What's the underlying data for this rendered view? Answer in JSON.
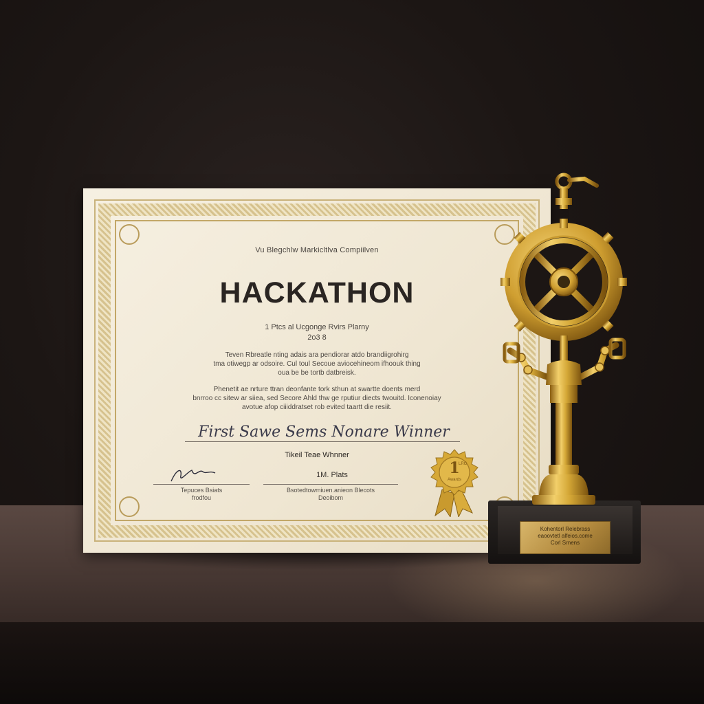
{
  "certificate": {
    "subtitle": "Vu Blegchlw Markicltlva Compiilven",
    "title": "HACKATHON",
    "place_line": "1 Ptcs al Ucgonge Rvirs Plarny",
    "year": "2o3 8",
    "paragraph1": [
      "Teven Rbreatle nting adais ara pendiorar atdo brandiigrohirg",
      "tma otiwegp ar odsoire. Cul toul Secoue aviocehineom ifhoouk thing",
      "oua be be tortb datbreisk."
    ],
    "paragraph2": [
      "Phenetit ae nrture ttran deonfante tork sthun at swartte doents merd",
      "bnrroo cc sitew ar siiea, sed Secore Ahld thw ge rputiur diects twouitd. Iconenoiay",
      "avotue afop ciiiddratset rob evited taartt die resiit."
    ],
    "script_title": "First Sawe Sems Nonare Winner",
    "winner_label": "Tikeil Teae Whnner",
    "sig_left_label": [
      "Tepuces Bsiats",
      "frodfou"
    ],
    "place_label": "1M. Plats",
    "sig_right_label": [
      "Bsotedtowmiuen.anieon Blecots",
      "Deoibom"
    ]
  },
  "seal": {
    "text_big": "1",
    "text_sup": "LRG",
    "text_small": "Awards"
  },
  "trophy": {
    "plaque_lines": [
      "Kohentorl Relebrass",
      "eaoovtetl alfeios.come",
      "Corl Srnens"
    ]
  },
  "colors": {
    "background": "#1c1614",
    "gold": "#d4a736",
    "paper": "#f3ecdc"
  }
}
